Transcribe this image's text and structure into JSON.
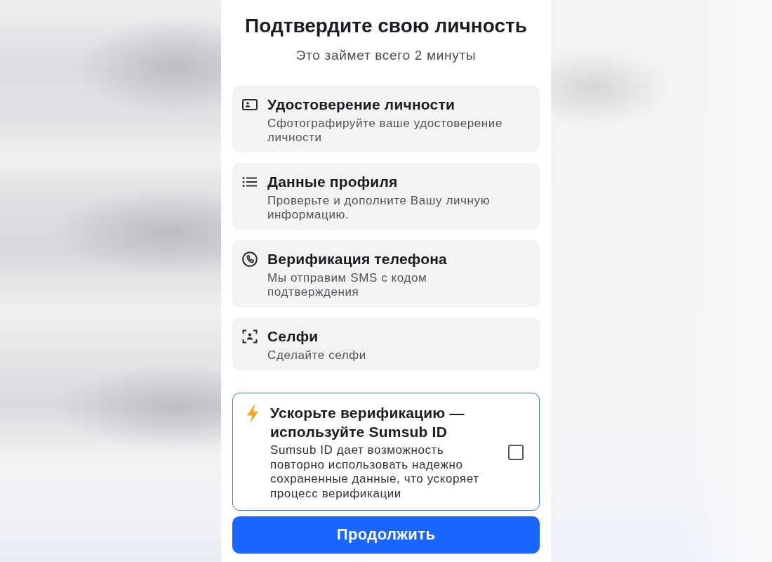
{
  "header": {
    "title": "Подтвердите свою личность",
    "subtitle": "Это займет всего 2 минуты"
  },
  "steps": [
    {
      "kind": "document",
      "title": "Удостоверение личности",
      "description": "Сфотографируйте ваше удостоверение личности"
    },
    {
      "kind": "profile",
      "title": "Данные профиля",
      "description": "Проверьте и дополните Вашу личную информацию."
    },
    {
      "kind": "phone",
      "title": "Верификация телефона",
      "description": "Мы отправим SMS с кодом подтверждения"
    },
    {
      "kind": "selfie",
      "title": "Селфи",
      "description": "Сделайте селфи"
    }
  ],
  "sumsub_id_offer": {
    "title": "Ускорьте верификацию — используйте Sumsub ID",
    "description": "Sumsub ID дает возможность повторно использовать надежно сохраненные данные, что ускоряет процесс верификации",
    "checked": false
  },
  "continue_button": {
    "label": "Продолжить"
  }
}
